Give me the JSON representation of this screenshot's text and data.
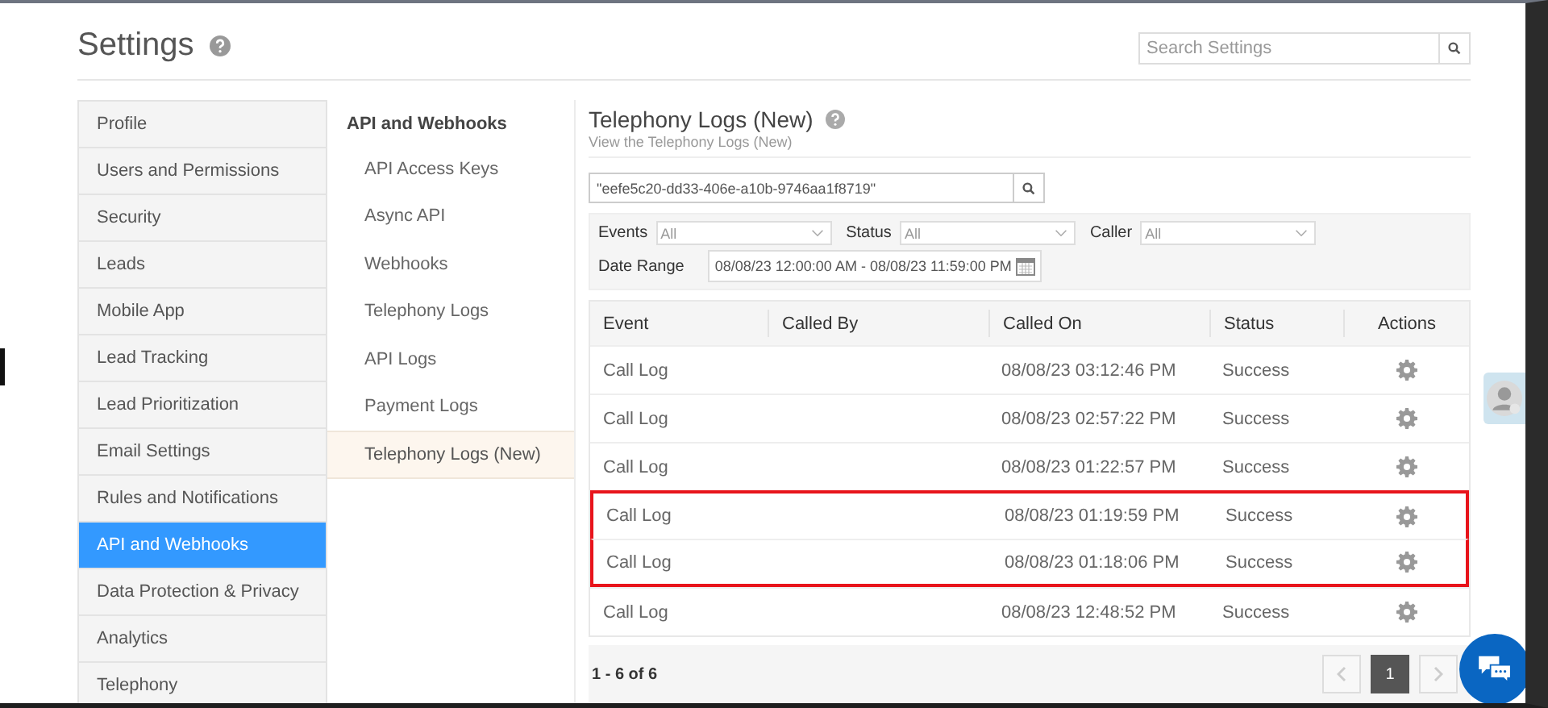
{
  "header": {
    "title": "Settings",
    "search": {
      "placeholder": "Search Settings"
    }
  },
  "nav": [
    {
      "label": "Profile",
      "selected": false
    },
    {
      "label": "Users and Permissions",
      "selected": false
    },
    {
      "label": "Security",
      "selected": false
    },
    {
      "label": "Leads",
      "selected": false
    },
    {
      "label": "Mobile App",
      "selected": false
    },
    {
      "label": "Lead Tracking",
      "selected": false
    },
    {
      "label": "Lead Prioritization",
      "selected": false
    },
    {
      "label": "Email Settings",
      "selected": false
    },
    {
      "label": "Rules and Notifications",
      "selected": false
    },
    {
      "label": "API and Webhooks",
      "selected": true
    },
    {
      "label": "Data Protection & Privacy",
      "selected": false
    },
    {
      "label": "Analytics",
      "selected": false
    },
    {
      "label": "Telephony",
      "selected": false
    }
  ],
  "subnav": {
    "title": "API and Webhooks",
    "items": [
      {
        "label": "API Access Keys",
        "selected": false
      },
      {
        "label": "Async API",
        "selected": false
      },
      {
        "label": "Webhooks",
        "selected": false
      },
      {
        "label": "Telephony Logs",
        "selected": false
      },
      {
        "label": "API Logs",
        "selected": false
      },
      {
        "label": "Payment Logs",
        "selected": false
      },
      {
        "label": "Telephony Logs (New)",
        "selected": true
      }
    ]
  },
  "content": {
    "title": "Telephony Logs (New)",
    "subtitle": "View the Telephony Logs (New)",
    "search": {
      "value": "\"eefe5c20-dd33-406e-a10b-9746aa1f8719\""
    },
    "filters": [
      {
        "label": "Events",
        "value": "All"
      },
      {
        "label": "Status",
        "value": "All"
      },
      {
        "label": "Caller",
        "value": "All"
      }
    ],
    "date_range": {
      "label": "Date Range",
      "value": "08/08/23 12:00:00 AM - 08/08/23 11:59:00 PM"
    },
    "table": {
      "columns": [
        "Event",
        "Called By",
        "Called On",
        "Status",
        "Actions"
      ],
      "rows": [
        {
          "event": "Call Log",
          "called_on": "08/08/23 03:12:46 PM",
          "status": "Success",
          "highlighted": false
        },
        {
          "event": "Call Log",
          "called_on": "08/08/23 02:57:22 PM",
          "status": "Success",
          "highlighted": false
        },
        {
          "event": "Call Log",
          "called_on": "08/08/23 01:22:57 PM",
          "status": "Success",
          "highlighted": false
        },
        {
          "event": "Call Log",
          "called_on": "08/08/23 01:19:59 PM",
          "status": "Success",
          "highlighted": true
        },
        {
          "event": "Call Log",
          "called_on": "08/08/23 01:18:06 PM",
          "status": "Success",
          "highlighted": true
        },
        {
          "event": "Call Log",
          "called_on": "08/08/23 12:48:52 PM",
          "status": "Success",
          "highlighted": false
        }
      ]
    },
    "pagination": {
      "summary": "1 - 6 of 6",
      "pages": [
        {
          "label": "1",
          "selected": true
        }
      ]
    }
  }
}
